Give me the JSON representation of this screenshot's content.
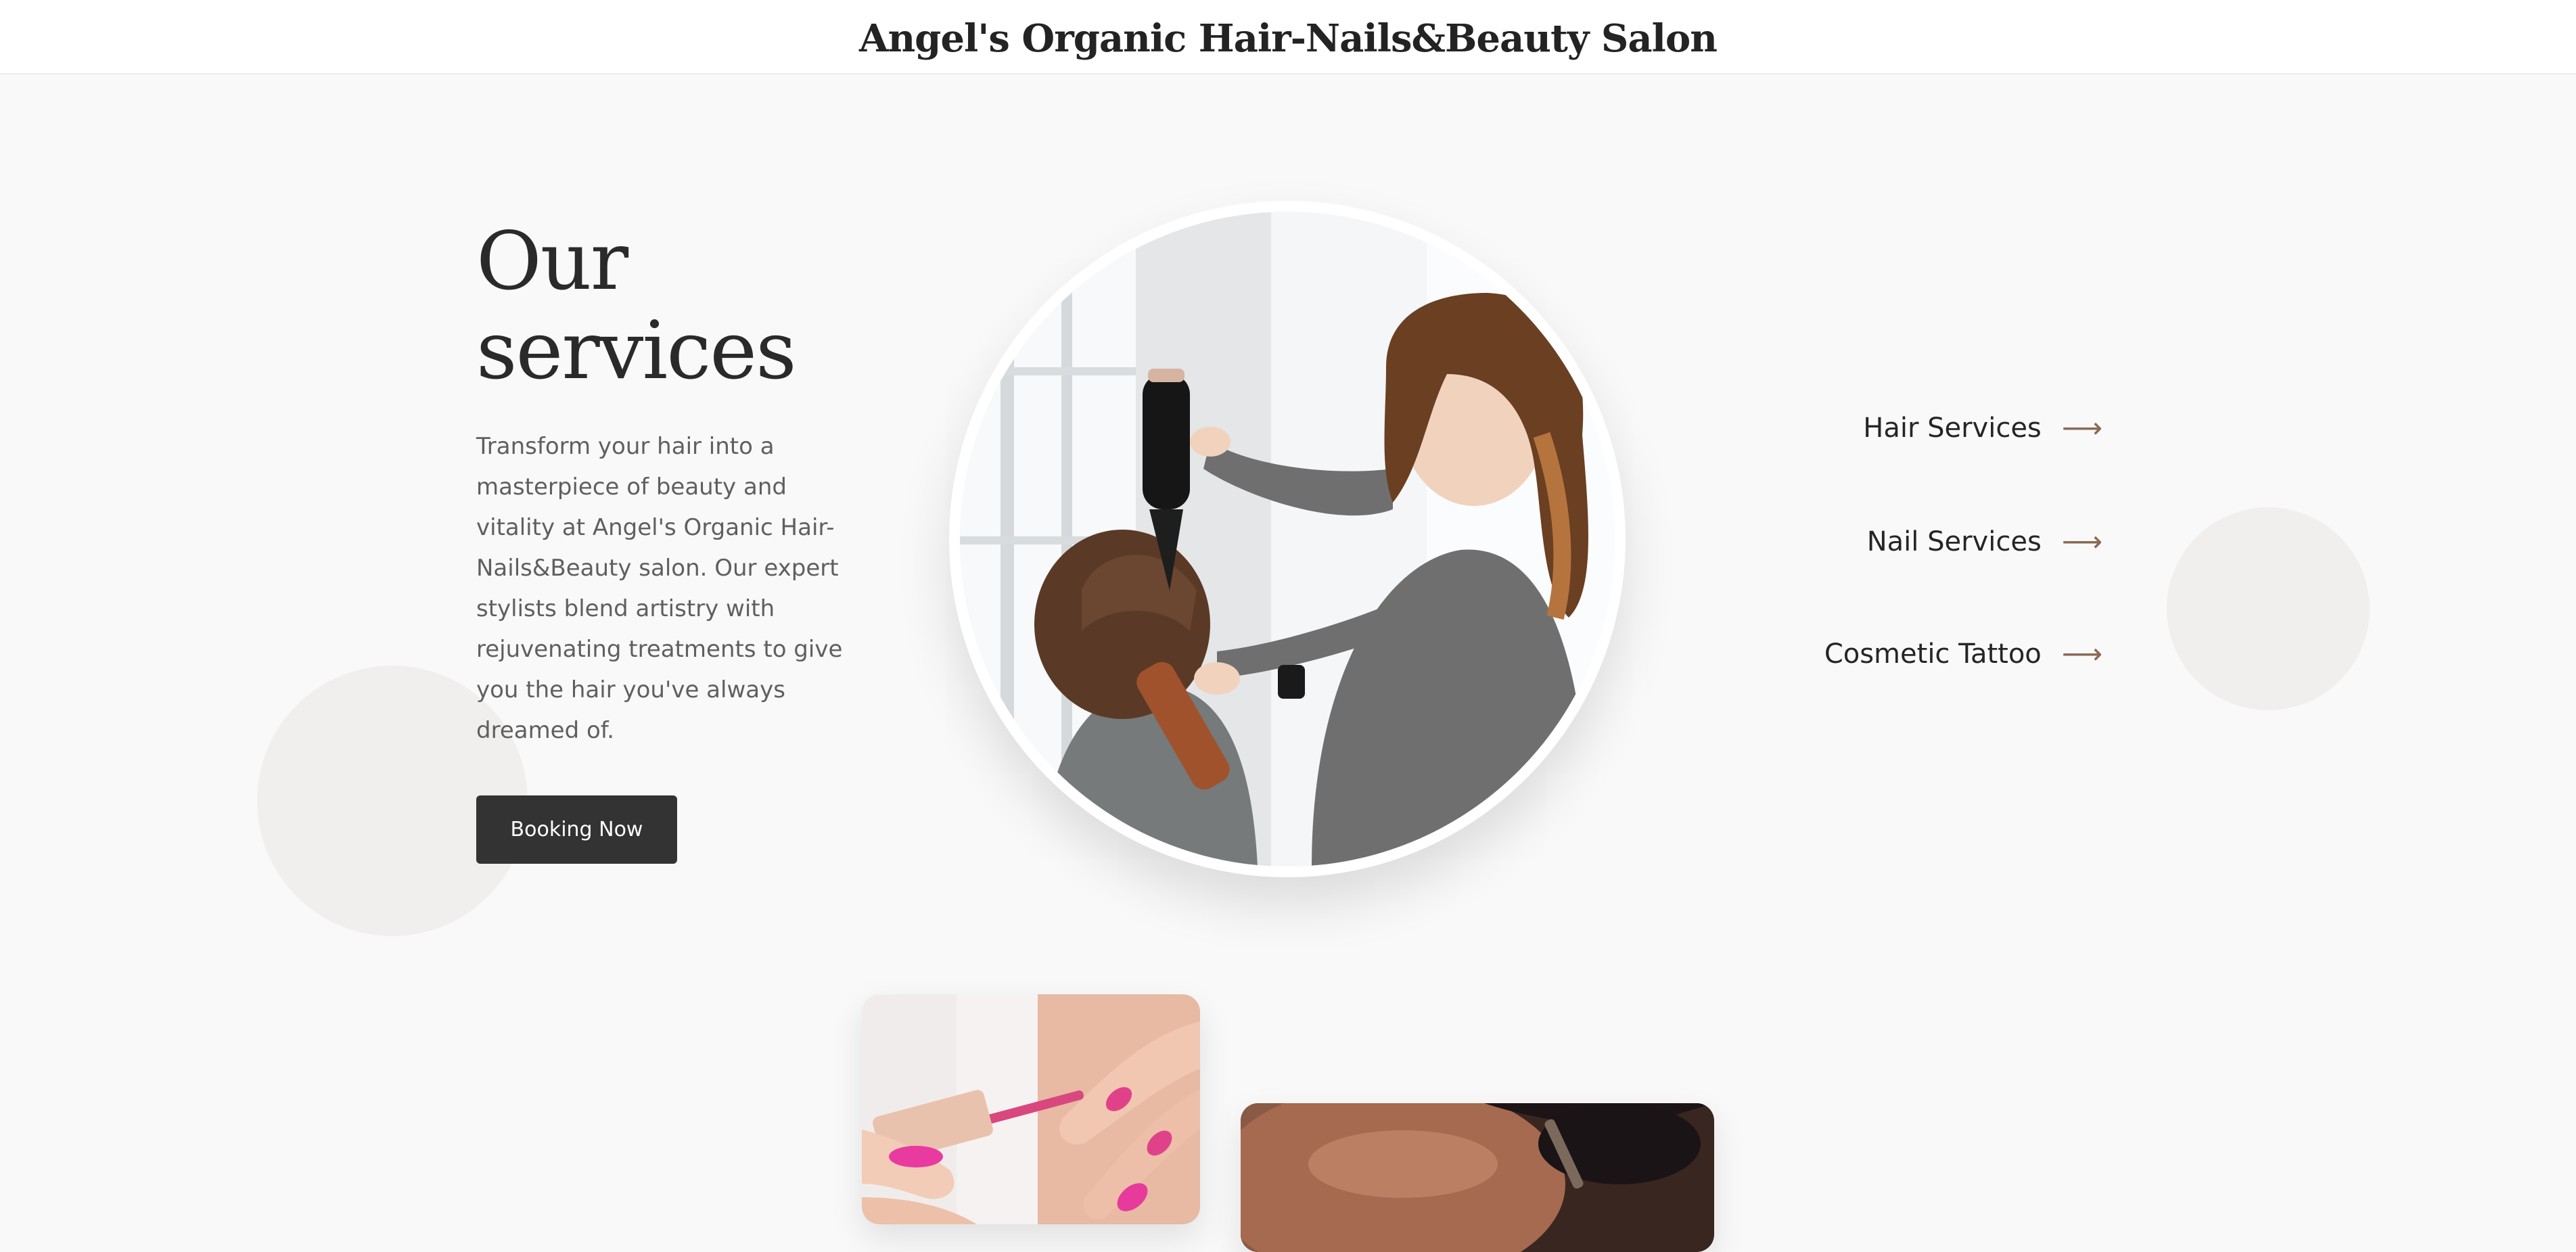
{
  "header": {
    "title": "Angel's Organic Hair-Nails&Beauty Salon"
  },
  "hero": {
    "heading_line1": "Our",
    "heading_line2": "services",
    "description": "Transform your hair into a masterpiece of beauty and vitality at Angel's Organic Hair-Nails&Beauty salon. Our expert stylists blend artistry with rejuvenating treatments to give you the hair you've always dreamed of.",
    "cta_label": "Booking Now"
  },
  "services": [
    {
      "label": "Hair Services",
      "icon": "arrow-right-icon"
    },
    {
      "label": "Nail Services",
      "icon": "arrow-right-icon"
    },
    {
      "label": "Cosmetic Tattoo",
      "icon": "arrow-right-icon"
    }
  ],
  "colors": {
    "background": "#f9f9f9",
    "header_background": "#ffffff",
    "text_dark": "#2a2a2a",
    "text_body": "#5f5f5f",
    "button": "#333333",
    "arrow_accent": "#8a6a55",
    "decor_circle": "#f0efee"
  }
}
